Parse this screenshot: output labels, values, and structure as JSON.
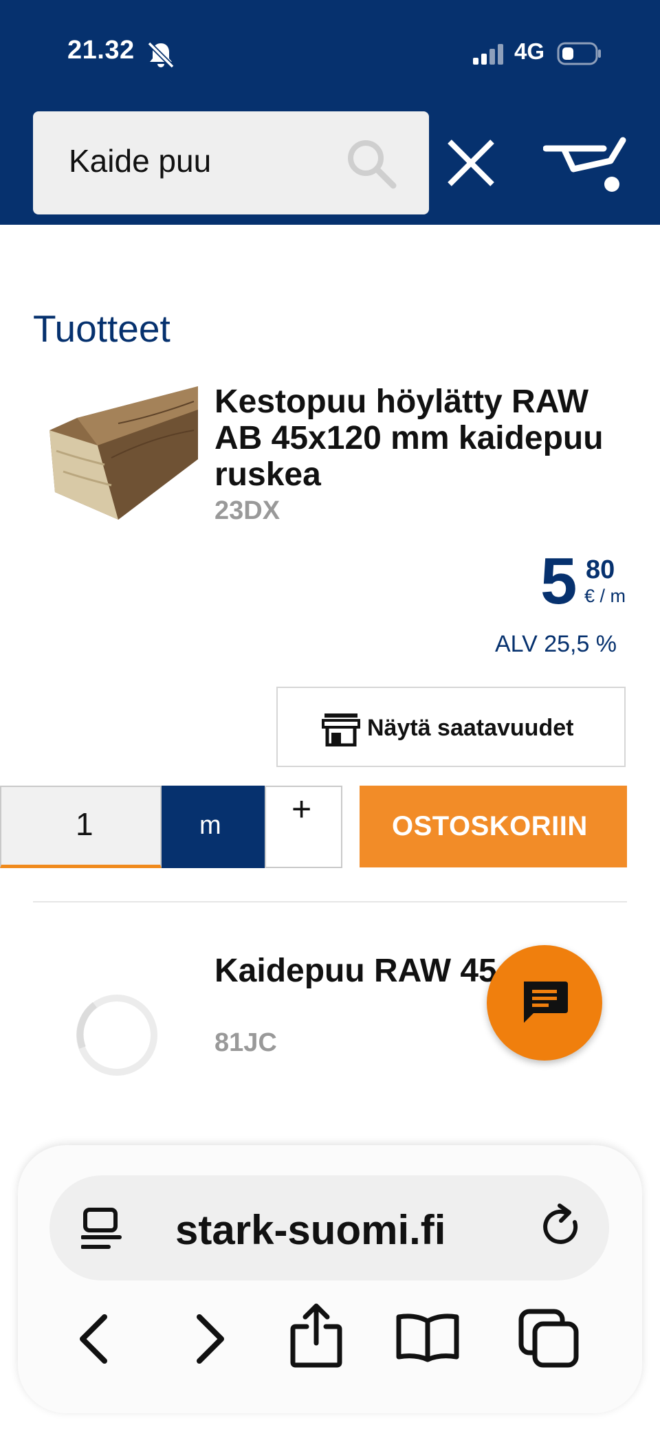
{
  "status_bar": {
    "time": "21.32",
    "network": "4G"
  },
  "header": {
    "search_value": "Kaide puu"
  },
  "section_title": "Tuotteet",
  "products": [
    {
      "title": "Kestopuu höylätty RAW AB 45x120 mm kaidepuu ruskea",
      "code": "23DX",
      "price_integer": "5",
      "price_decimal": "80",
      "price_unit": "€ / m",
      "vat": "ALV 25,5 %",
      "availability_label": "Näytä saatavuudet",
      "quantity": "1",
      "unit": "m",
      "plus_label": "+",
      "add_to_cart_label": "OSTOSKORIIN"
    },
    {
      "title": "Kaidepuu RAW 45 mm",
      "code": "81JC"
    }
  ],
  "browser": {
    "url": "stark-suomi.fi"
  },
  "colors": {
    "brand_blue": "#06316e",
    "accent_orange": "#f28c28",
    "chat_orange": "#f07f0d"
  },
  "icons": [
    "mute-bell-icon",
    "signal-icon",
    "battery-icon",
    "search-icon",
    "close-icon",
    "cart-icon",
    "store-icon",
    "chat-icon",
    "reader-icon",
    "reload-icon",
    "back-icon",
    "forward-icon",
    "share-icon",
    "bookmarks-icon",
    "tabs-icon"
  ]
}
